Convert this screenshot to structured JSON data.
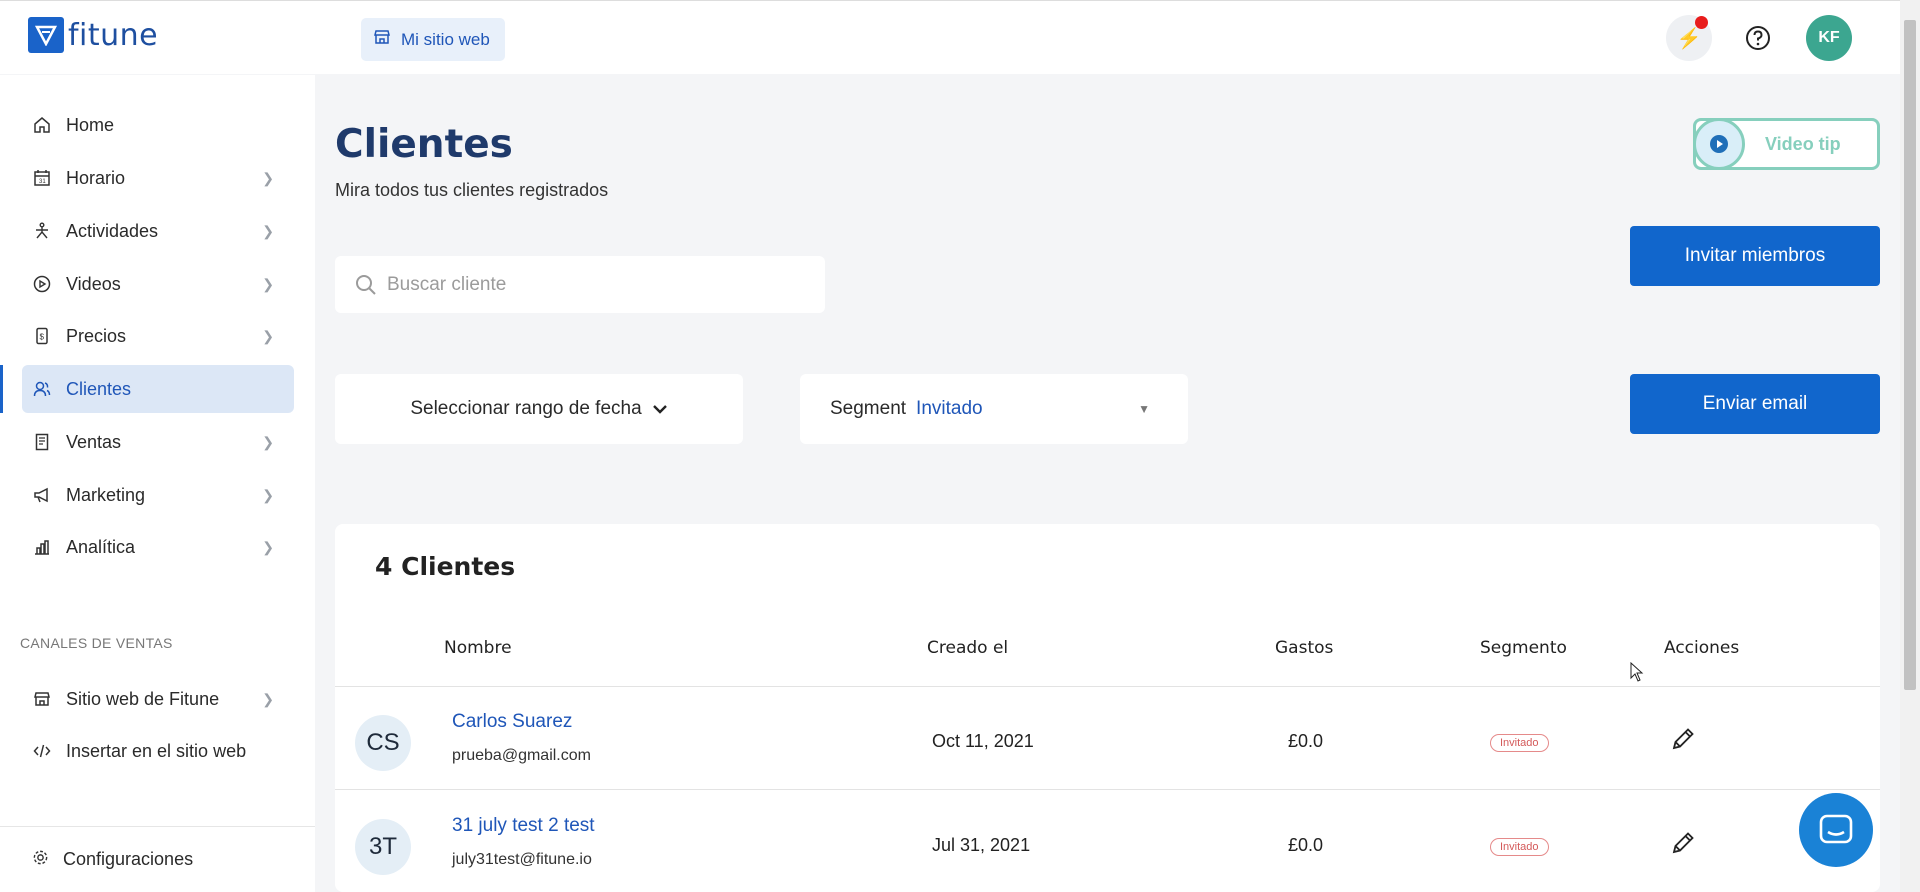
{
  "app": {
    "logo_text": "fitune",
    "site_button": "Mi sitio web",
    "avatar_initials": "KF"
  },
  "sidebar": {
    "items": [
      {
        "label": "Home",
        "icon": "home-icon",
        "chevron": false
      },
      {
        "label": "Horario",
        "icon": "calendar-icon",
        "chevron": true
      },
      {
        "label": "Actividades",
        "icon": "activity-icon",
        "chevron": true
      },
      {
        "label": "Videos",
        "icon": "play-icon",
        "chevron": true
      },
      {
        "label": "Precios",
        "icon": "price-icon",
        "chevron": true
      },
      {
        "label": "Clientes",
        "icon": "users-icon",
        "chevron": false,
        "active": true
      },
      {
        "label": "Ventas",
        "icon": "receipt-icon",
        "chevron": true
      },
      {
        "label": "Marketing",
        "icon": "megaphone-icon",
        "chevron": true
      },
      {
        "label": "Analítica",
        "icon": "chart-icon",
        "chevron": true
      }
    ],
    "section_title": "CANALES DE VENTAS",
    "channels": [
      {
        "label": "Sitio web de Fitune",
        "icon": "store-icon",
        "chevron": true
      },
      {
        "label": "Insertar en el sitio web",
        "icon": "code-icon",
        "chevron": false
      }
    ],
    "config_label": "Configuraciones"
  },
  "main": {
    "title": "Clientes",
    "subtitle": "Mira todos tus clientes registrados",
    "video_tip": "Video tip",
    "invite_button": "Invitar miembros",
    "email_button": "Enviar email",
    "search_placeholder": "Buscar cliente",
    "date_range": "Seleccionar rango de fecha",
    "segment_label": "Segment",
    "segment_value": "Invitado"
  },
  "table": {
    "count_title": "4 Clientes",
    "headers": {
      "name": "Nombre",
      "created": "Creado el",
      "spend": "Gastos",
      "segment": "Segmento",
      "actions": "Acciones"
    },
    "rows": [
      {
        "initials": "CS",
        "name": "Carlos Suarez",
        "email": "prueba@gmail.com",
        "created": "Oct 11, 2021",
        "spend": "£0.0",
        "segment": "Invitado"
      },
      {
        "initials": "3T",
        "name": "31 july test 2 test",
        "email": "july31test@fitune.io",
        "created": "Jul 31, 2021",
        "spend": "£0.0",
        "segment": "Invitado"
      }
    ]
  },
  "colors": {
    "accent": "#1166cc",
    "brand": "#1e4fa0",
    "badge": "#e58a8a",
    "avatar": "#3ca690",
    "tip": "#86cfbd"
  }
}
